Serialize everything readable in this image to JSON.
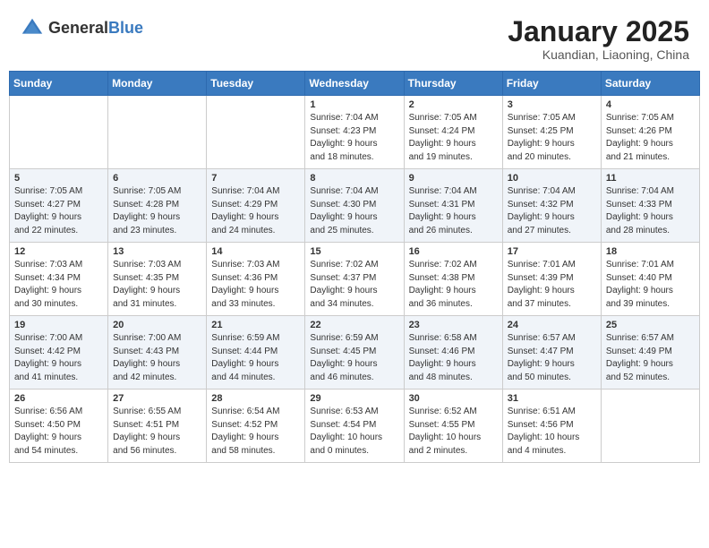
{
  "header": {
    "logo_general": "General",
    "logo_blue": "Blue",
    "title": "January 2025",
    "location": "Kuandian, Liaoning, China"
  },
  "calendar": {
    "days_of_week": [
      "Sunday",
      "Monday",
      "Tuesday",
      "Wednesday",
      "Thursday",
      "Friday",
      "Saturday"
    ],
    "weeks": [
      [
        {
          "day": "",
          "info": ""
        },
        {
          "day": "",
          "info": ""
        },
        {
          "day": "",
          "info": ""
        },
        {
          "day": "1",
          "info": "Sunrise: 7:04 AM\nSunset: 4:23 PM\nDaylight: 9 hours\nand 18 minutes."
        },
        {
          "day": "2",
          "info": "Sunrise: 7:05 AM\nSunset: 4:24 PM\nDaylight: 9 hours\nand 19 minutes."
        },
        {
          "day": "3",
          "info": "Sunrise: 7:05 AM\nSunset: 4:25 PM\nDaylight: 9 hours\nand 20 minutes."
        },
        {
          "day": "4",
          "info": "Sunrise: 7:05 AM\nSunset: 4:26 PM\nDaylight: 9 hours\nand 21 minutes."
        }
      ],
      [
        {
          "day": "5",
          "info": "Sunrise: 7:05 AM\nSunset: 4:27 PM\nDaylight: 9 hours\nand 22 minutes."
        },
        {
          "day": "6",
          "info": "Sunrise: 7:05 AM\nSunset: 4:28 PM\nDaylight: 9 hours\nand 23 minutes."
        },
        {
          "day": "7",
          "info": "Sunrise: 7:04 AM\nSunset: 4:29 PM\nDaylight: 9 hours\nand 24 minutes."
        },
        {
          "day": "8",
          "info": "Sunrise: 7:04 AM\nSunset: 4:30 PM\nDaylight: 9 hours\nand 25 minutes."
        },
        {
          "day": "9",
          "info": "Sunrise: 7:04 AM\nSunset: 4:31 PM\nDaylight: 9 hours\nand 26 minutes."
        },
        {
          "day": "10",
          "info": "Sunrise: 7:04 AM\nSunset: 4:32 PM\nDaylight: 9 hours\nand 27 minutes."
        },
        {
          "day": "11",
          "info": "Sunrise: 7:04 AM\nSunset: 4:33 PM\nDaylight: 9 hours\nand 28 minutes."
        }
      ],
      [
        {
          "day": "12",
          "info": "Sunrise: 7:03 AM\nSunset: 4:34 PM\nDaylight: 9 hours\nand 30 minutes."
        },
        {
          "day": "13",
          "info": "Sunrise: 7:03 AM\nSunset: 4:35 PM\nDaylight: 9 hours\nand 31 minutes."
        },
        {
          "day": "14",
          "info": "Sunrise: 7:03 AM\nSunset: 4:36 PM\nDaylight: 9 hours\nand 33 minutes."
        },
        {
          "day": "15",
          "info": "Sunrise: 7:02 AM\nSunset: 4:37 PM\nDaylight: 9 hours\nand 34 minutes."
        },
        {
          "day": "16",
          "info": "Sunrise: 7:02 AM\nSunset: 4:38 PM\nDaylight: 9 hours\nand 36 minutes."
        },
        {
          "day": "17",
          "info": "Sunrise: 7:01 AM\nSunset: 4:39 PM\nDaylight: 9 hours\nand 37 minutes."
        },
        {
          "day": "18",
          "info": "Sunrise: 7:01 AM\nSunset: 4:40 PM\nDaylight: 9 hours\nand 39 minutes."
        }
      ],
      [
        {
          "day": "19",
          "info": "Sunrise: 7:00 AM\nSunset: 4:42 PM\nDaylight: 9 hours\nand 41 minutes."
        },
        {
          "day": "20",
          "info": "Sunrise: 7:00 AM\nSunset: 4:43 PM\nDaylight: 9 hours\nand 42 minutes."
        },
        {
          "day": "21",
          "info": "Sunrise: 6:59 AM\nSunset: 4:44 PM\nDaylight: 9 hours\nand 44 minutes."
        },
        {
          "day": "22",
          "info": "Sunrise: 6:59 AM\nSunset: 4:45 PM\nDaylight: 9 hours\nand 46 minutes."
        },
        {
          "day": "23",
          "info": "Sunrise: 6:58 AM\nSunset: 4:46 PM\nDaylight: 9 hours\nand 48 minutes."
        },
        {
          "day": "24",
          "info": "Sunrise: 6:57 AM\nSunset: 4:47 PM\nDaylight: 9 hours\nand 50 minutes."
        },
        {
          "day": "25",
          "info": "Sunrise: 6:57 AM\nSunset: 4:49 PM\nDaylight: 9 hours\nand 52 minutes."
        }
      ],
      [
        {
          "day": "26",
          "info": "Sunrise: 6:56 AM\nSunset: 4:50 PM\nDaylight: 9 hours\nand 54 minutes."
        },
        {
          "day": "27",
          "info": "Sunrise: 6:55 AM\nSunset: 4:51 PM\nDaylight: 9 hours\nand 56 minutes."
        },
        {
          "day": "28",
          "info": "Sunrise: 6:54 AM\nSunset: 4:52 PM\nDaylight: 9 hours\nand 58 minutes."
        },
        {
          "day": "29",
          "info": "Sunrise: 6:53 AM\nSunset: 4:54 PM\nDaylight: 10 hours\nand 0 minutes."
        },
        {
          "day": "30",
          "info": "Sunrise: 6:52 AM\nSunset: 4:55 PM\nDaylight: 10 hours\nand 2 minutes."
        },
        {
          "day": "31",
          "info": "Sunrise: 6:51 AM\nSunset: 4:56 PM\nDaylight: 10 hours\nand 4 minutes."
        },
        {
          "day": "",
          "info": ""
        }
      ]
    ]
  }
}
